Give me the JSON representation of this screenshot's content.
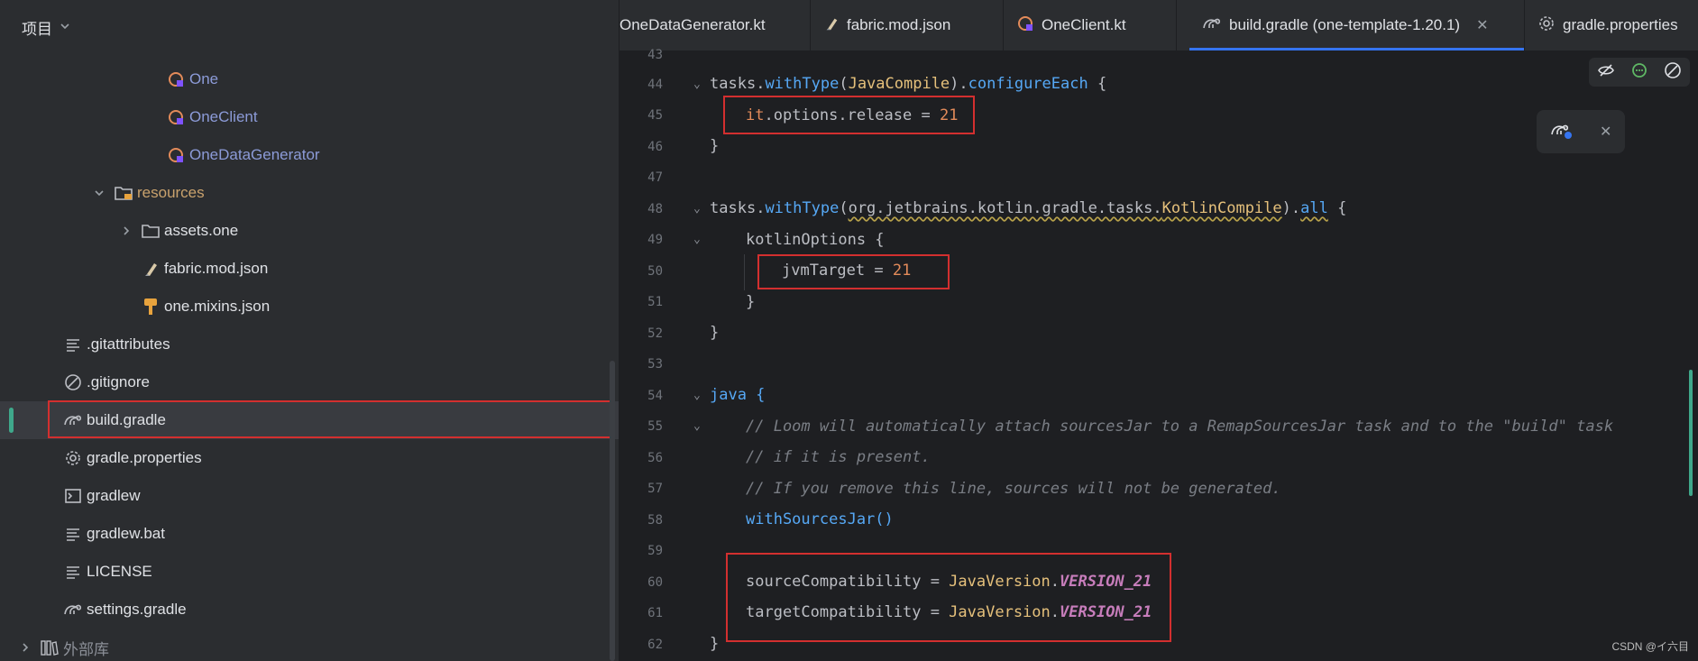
{
  "sidebar": {
    "header": "项目",
    "items": [
      {
        "label": "One",
        "icon": "kotlin-class-icon"
      },
      {
        "label": "OneClient",
        "icon": "kotlin-class-icon"
      },
      {
        "label": "OneDataGenerator",
        "icon": "kotlin-class-icon"
      },
      {
        "label": "resources",
        "icon": "folder-resources-icon"
      },
      {
        "label": "assets.one",
        "icon": "folder-icon"
      },
      {
        "label": "fabric.mod.json",
        "icon": "json-icon"
      },
      {
        "label": "one.mixins.json",
        "icon": "mixins-json-icon"
      },
      {
        "label": ".gitattributes",
        "icon": "text-lines-icon"
      },
      {
        "label": ".gitignore",
        "icon": "ignore-icon"
      },
      {
        "label": "build.gradle",
        "icon": "gradle-icon"
      },
      {
        "label": "gradle.properties",
        "icon": "gear-icon"
      },
      {
        "label": "gradlew",
        "icon": "terminal-icon"
      },
      {
        "label": "gradlew.bat",
        "icon": "text-lines-icon"
      },
      {
        "label": "LICENSE",
        "icon": "text-lines-icon"
      },
      {
        "label": "settings.gradle",
        "icon": "gradle-icon"
      },
      {
        "label": "外部库",
        "icon": "library-icon"
      }
    ]
  },
  "tabs": [
    {
      "label": "OneDataGenerator.kt",
      "icon": "kotlin-class-icon"
    },
    {
      "label": "fabric.mod.json",
      "icon": "json-icon"
    },
    {
      "label": "OneClient.kt",
      "icon": "kotlin-class-icon"
    },
    {
      "label": "build.gradle (one-template-1.20.1)",
      "icon": "gradle-icon",
      "active": true
    },
    {
      "label": "gradle.properties",
      "icon": "gear-icon"
    }
  ],
  "editor": {
    "line_numbers": [
      "43",
      "44",
      "45",
      "46",
      "47",
      "48",
      "49",
      "50",
      "51",
      "52",
      "53",
      "54",
      "55",
      "56",
      "57",
      "58",
      "59",
      "60",
      "61",
      "62"
    ],
    "code": {
      "l44_a": "tasks",
      "l44_b": ".",
      "l44_c": "withType",
      "l44_d": "(",
      "l44_e": "JavaCompile",
      "l44_f": ").",
      "l44_g": "configureEach",
      "l44_h": " {",
      "l45_a": "it",
      "l45_b": ".options.release = ",
      "l45_c": "21",
      "l46": "}",
      "l48_a": "tasks",
      "l48_b": ".",
      "l48_c": "withType",
      "l48_d": "(",
      "l48_e": "org.jetbrains.kotlin.gradle.tasks.",
      "l48_f": "KotlinCompile",
      "l48_g": ").",
      "l48_h": "all",
      "l48_i": " {",
      "l49": "kotlinOptions {",
      "l50_a": "jvmTarget = ",
      "l50_b": "21",
      "l51": "}",
      "l52": "}",
      "l54": "java {",
      "l55": "// Loom will automatically attach sourcesJar to a RemapSourcesJar task and to the \"build\" task",
      "l56": "// if it is present.",
      "l57": "// If you remove this line, sources will not be generated.",
      "l58": "withSourcesJar()",
      "l60_a": "sourceCompatibility = ",
      "l60_b": "JavaVersion",
      "l60_c": ".",
      "l60_d": "VERSION_21",
      "l61_a": "targetCompatibility = ",
      "l61_b": "JavaVersion",
      "l61_c": ".",
      "l61_d": "VERSION_21",
      "l62": "}"
    }
  },
  "watermark": "CSDN @イ六目",
  "colors": {
    "highlight_box": "#d32f2f",
    "accent_blue": "#3574f0",
    "accent_green": "#3fa88b"
  }
}
